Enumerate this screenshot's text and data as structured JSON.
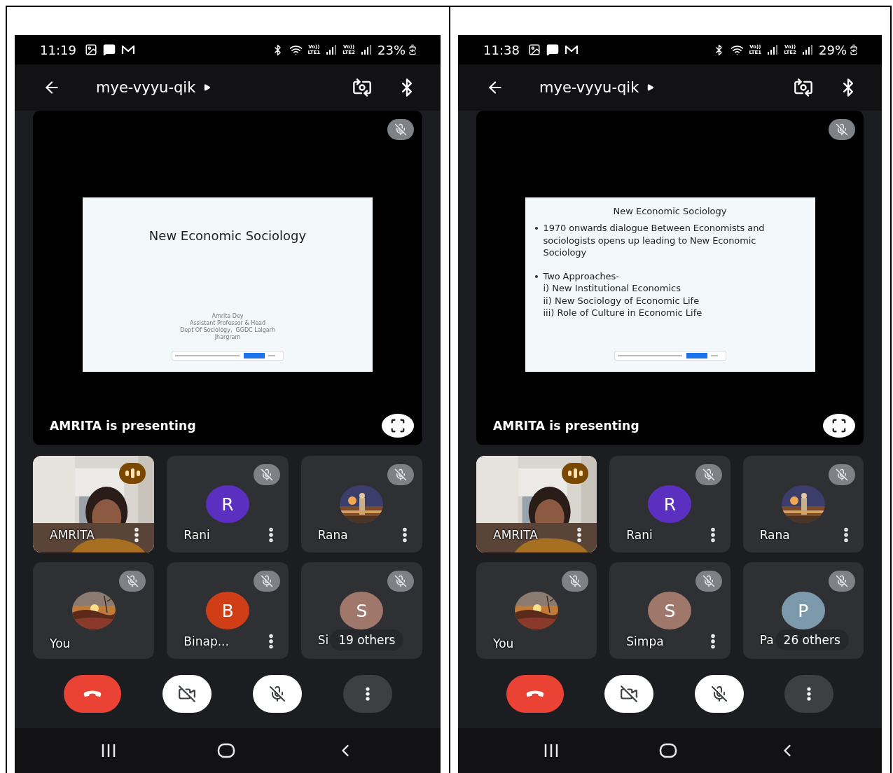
{
  "screens": [
    {
      "status_bar": {
        "time": "11:19",
        "volte": [
          {
            "top": "Vo))",
            "bottom": "LTE1"
          },
          {
            "top": "Vo))",
            "bottom": "LTE2"
          }
        ],
        "battery": "23%"
      },
      "header": {
        "title": "mye-vyyu-qik"
      },
      "presentation": {
        "presenter_muted": true,
        "slide": {
          "kind": "title",
          "title": "New Economic Sociology",
          "lines": [
            "Amrita Dey",
            "Assistant Professor & Head",
            "Dept Of Sociology,  GGDC Lalgarh",
            "Jhargram"
          ]
        },
        "caption": "AMRITA is presenting"
      },
      "tiles": [
        {
          "kind": "video",
          "name": "AMRITA",
          "muted": false,
          "speaking": true,
          "menu": true
        },
        {
          "kind": "initial",
          "initial": "R",
          "color": "#5b2fbf",
          "name": "Rani",
          "muted": true,
          "speaking": false,
          "menu": true
        },
        {
          "name": "Rana",
          "muted": true,
          "speaking": false,
          "menu": true
        },
        {
          "name": "You",
          "muted": true,
          "speaking": false,
          "menu": false
        },
        {
          "kind": "initial",
          "initial": "B",
          "color": "#cf3e17",
          "name": "Binap...",
          "muted": true,
          "speaking": false,
          "menu": true
        },
        {
          "kind": "initial",
          "initial": "S",
          "color": "#a0776b",
          "name": "Si",
          "muted": true,
          "speaking": false,
          "menu": false,
          "others": "19 others"
        }
      ],
      "controls": [
        {
          "kind": "end_call"
        },
        {
          "kind": "camera",
          "on": false
        },
        {
          "kind": "mic",
          "on": false
        },
        {
          "kind": "more"
        }
      ]
    },
    {
      "status_bar": {
        "time": "11:38",
        "volte": [
          {
            "top": "Vo))",
            "bottom": "LTE1"
          },
          {
            "top": "Vo))",
            "bottom": "LTE2"
          }
        ],
        "battery": "29%"
      },
      "header": {
        "title": "mye-vyyu-qik"
      },
      "presentation": {
        "presenter_muted": true,
        "slide": {
          "kind": "bullets",
          "title": "New Economic Sociology",
          "bullets": [
            {
              "text": "1970 onwards dialogue  Between Economists and sociologists opens up leading to New Economic Sociology"
            },
            {
              "text": "Two Approaches-",
              "lines": [
                "i) New Institutional Economics",
                "ii) New Sociology of Economic Life",
                "iii) Role of Culture in Economic Life"
              ]
            }
          ]
        },
        "caption": "AMRITA is presenting"
      },
      "tiles": [
        {
          "kind": "video",
          "name": "AMRITA",
          "muted": false,
          "speaking": true,
          "menu": true
        },
        {
          "kind": "initial",
          "initial": "R",
          "color": "#5b2fbf",
          "name": "Rani",
          "muted": true,
          "speaking": false,
          "menu": true
        },
        {
          "name": "Rana",
          "muted": true,
          "speaking": false,
          "menu": true
        },
        {
          "name": "You",
          "muted": true,
          "speaking": false,
          "menu": false
        },
        {
          "kind": "initial",
          "initial": "S",
          "color": "#a0776b",
          "name": "Simpa",
          "muted": true,
          "speaking": false,
          "menu": true
        },
        {
          "kind": "initial",
          "initial": "P",
          "color": "#7d9aad",
          "name": "Pa",
          "muted": true,
          "speaking": false,
          "menu": false,
          "others": "26 others"
        }
      ],
      "controls": [
        {
          "kind": "end_call"
        },
        {
          "kind": "camera",
          "on": false
        },
        {
          "kind": "mic",
          "on": false
        },
        {
          "kind": "more"
        }
      ]
    }
  ]
}
